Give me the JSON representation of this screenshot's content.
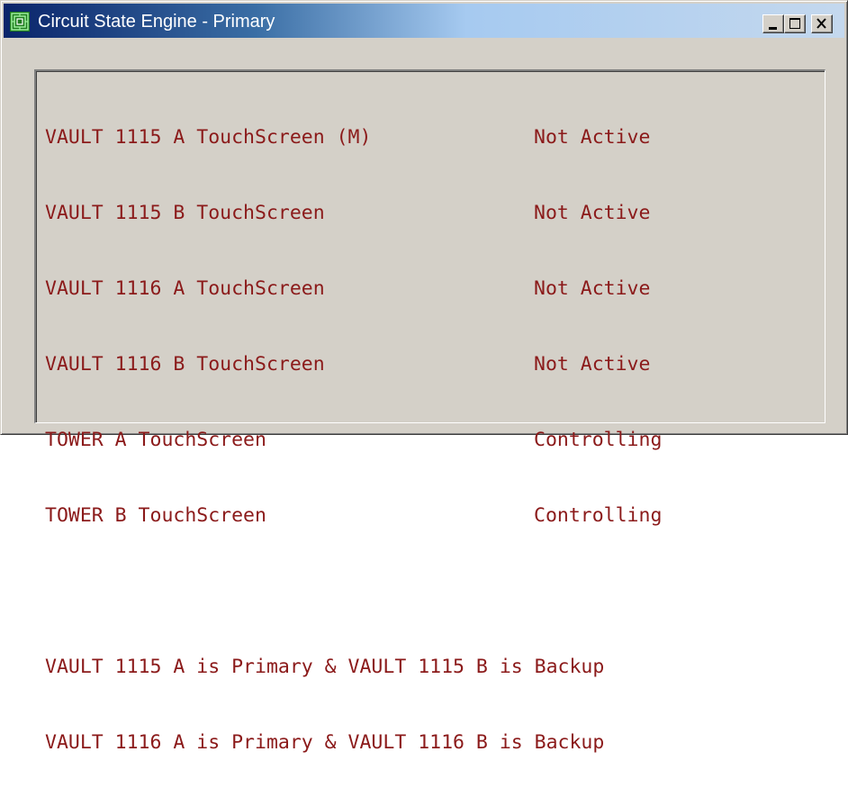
{
  "window": {
    "title": "Circuit State Engine - Primary",
    "icon": "app-circuit-icon",
    "buttons": {
      "minimize": "minimize-icon",
      "maximize": "maximize-icon",
      "close": "close-icon"
    }
  },
  "status_rows": [
    {
      "name": "VAULT 1115 A TouchScreen (M)",
      "state": "Not Active"
    },
    {
      "name": "VAULT 1115 B TouchScreen",
      "state": "Not Active"
    },
    {
      "name": "VAULT 1116 A TouchScreen",
      "state": "Not Active"
    },
    {
      "name": "VAULT 1116 B TouchScreen",
      "state": "Not Active"
    },
    {
      "name": "TOWER A TouchScreen",
      "state": "Controlling"
    },
    {
      "name": "TOWER B TouchScreen",
      "state": "Controlling"
    }
  ],
  "messages": [
    "VAULT 1115 A is Primary & VAULT 1115 B is Backup",
    "VAULT 1116 A is Primary & VAULT 1116 B is Backup"
  ],
  "colors": {
    "text": "#8b1a1a",
    "titlebar_start": "#0a246a",
    "titlebar_end": "#c4d8ee",
    "window_face": "#d4d0c8"
  }
}
